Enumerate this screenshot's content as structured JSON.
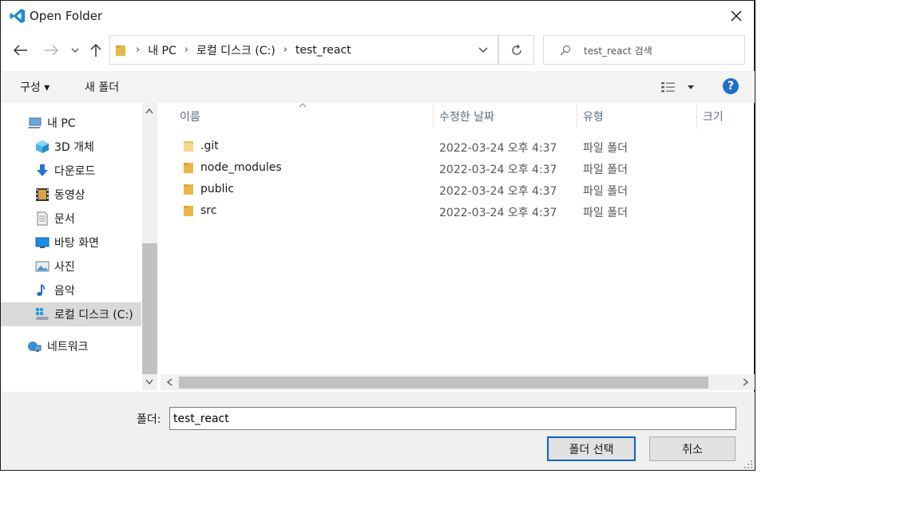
{
  "window": {
    "title": "Open Folder"
  },
  "address": {
    "crumbs": [
      "내 PC",
      "로컬 디스크 (C:)",
      "test_react"
    ]
  },
  "search": {
    "placeholder": "test_react 검색"
  },
  "toolbar": {
    "organize_label": "구성 ▾",
    "new_folder_label": "새 폴더",
    "help_label": "?"
  },
  "sidebar": {
    "items": [
      {
        "label": "내 PC",
        "icon": "computer-icon"
      },
      {
        "label": "3D 개체",
        "icon": "cube-icon"
      },
      {
        "label": "다운로드",
        "icon": "download-icon"
      },
      {
        "label": "동영상",
        "icon": "video-icon"
      },
      {
        "label": "문서",
        "icon": "document-icon"
      },
      {
        "label": "바탕 화면",
        "icon": "desktop-icon"
      },
      {
        "label": "사진",
        "icon": "picture-icon"
      },
      {
        "label": "음악",
        "icon": "music-icon"
      },
      {
        "label": "로컬 디스크 (C:)",
        "icon": "drive-icon",
        "selected": true
      },
      {
        "label": "네트워크",
        "icon": "network-icon"
      }
    ]
  },
  "columns": {
    "name": "이름",
    "date": "수정한 날짜",
    "type": "유형",
    "size": "크기"
  },
  "files": [
    {
      "name": ".git",
      "date": "2022-03-24 오후 4:37",
      "type": "파일 폴더"
    },
    {
      "name": "node_modules",
      "date": "2022-03-24 오후 4:37",
      "type": "파일 폴더"
    },
    {
      "name": "public",
      "date": "2022-03-24 오후 4:37",
      "type": "파일 폴더"
    },
    {
      "name": "src",
      "date": "2022-03-24 오후 4:37",
      "type": "파일 폴더"
    }
  ],
  "footer": {
    "folder_label": "폴더:",
    "folder_value": "test_react",
    "select_button": "폴더 선택",
    "cancel_button": "취소"
  },
  "colors": {
    "accent": "#0a64c8",
    "folder": "#e8b84a",
    "vscode_blue": "#1f8ad2"
  }
}
